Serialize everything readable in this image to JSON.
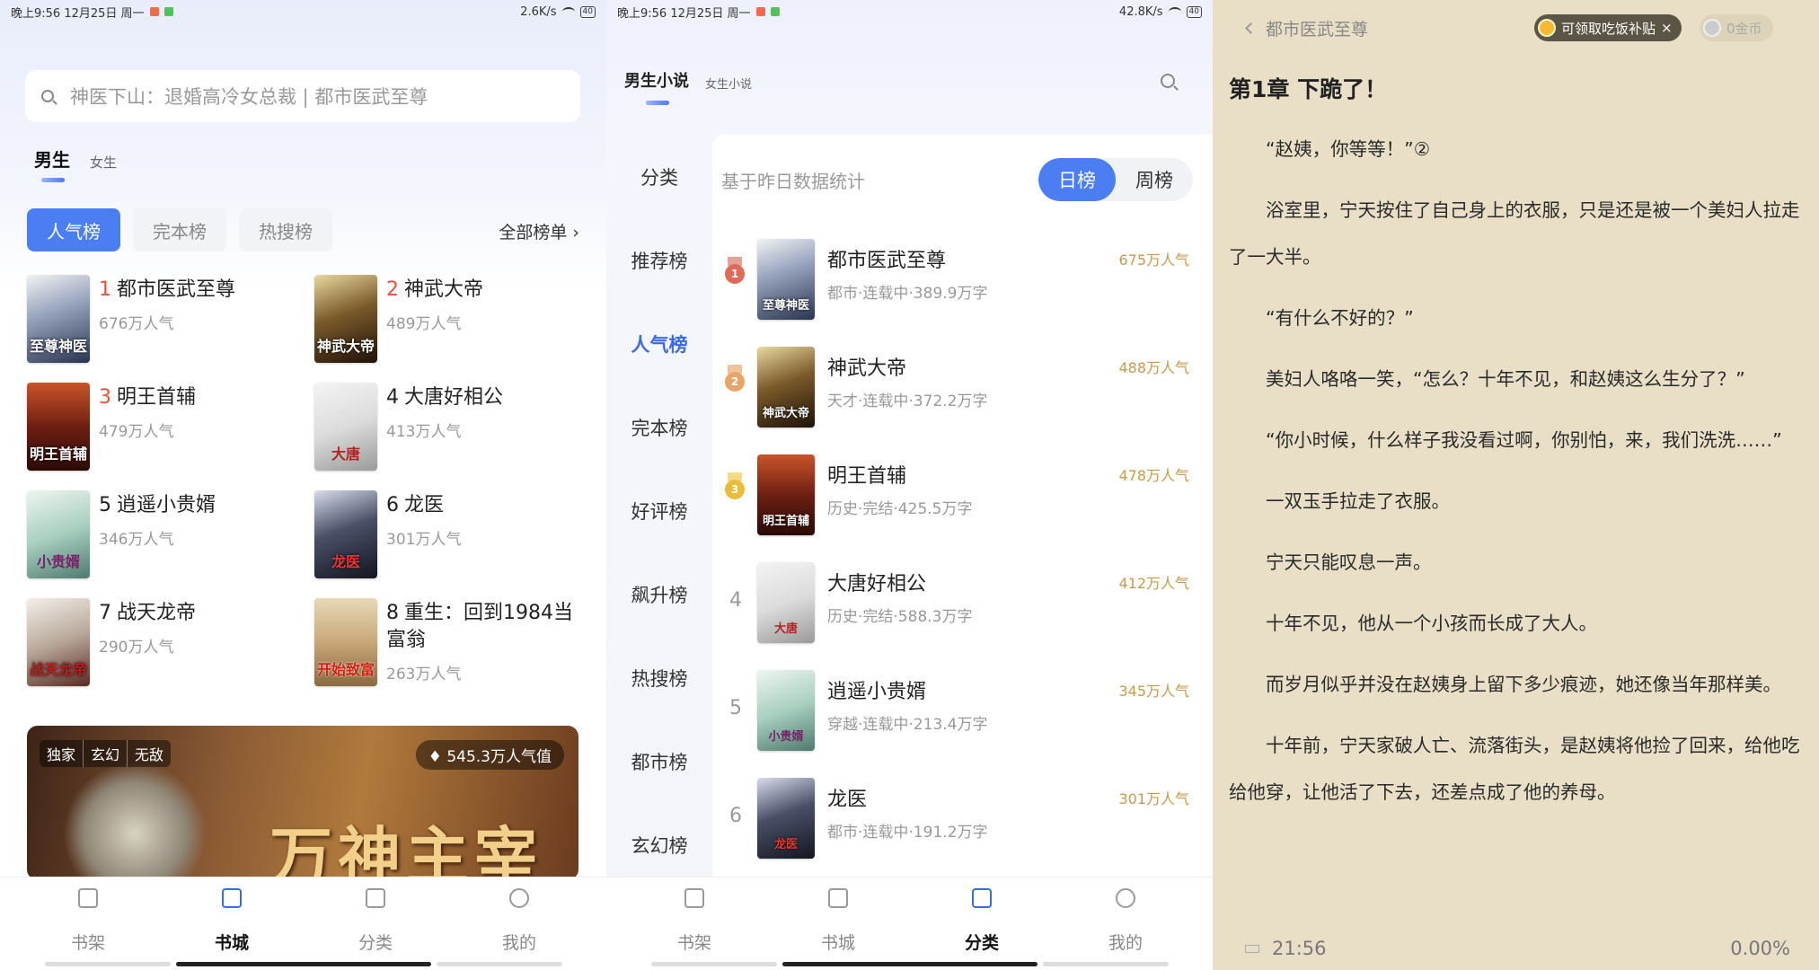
{
  "status1": {
    "left": "晚上9:56 12月25日 周一",
    "right": "2.6K/s",
    "battery": "40"
  },
  "status2": {
    "left": "晚上9:56 12月25日 周一",
    "right": "42.8K/s",
    "battery": "40"
  },
  "store": {
    "search_placeholder": "神医下山：退婚高冷女总裁 | 都市医武至尊",
    "gender_tabs": [
      "男生",
      "女生"
    ],
    "rank_tabs": [
      "人气榜",
      "完本榜",
      "热搜榜"
    ],
    "all_lists": "全部榜单 ›",
    "books": [
      {
        "rank": "1",
        "title": "都市医武至尊",
        "hot": "676万人气",
        "cover": "至尊神医"
      },
      {
        "rank": "2",
        "title": "神武大帝",
        "hot": "489万人气",
        "cover": "神武大帝"
      },
      {
        "rank": "3",
        "title": "明王首辅",
        "hot": "479万人气",
        "cover": "明王首辅"
      },
      {
        "rank": "4",
        "title": "大唐好相公",
        "hot": "413万人气",
        "cover": "大唐"
      },
      {
        "rank": "5",
        "title": "逍遥小贵婿",
        "hot": "346万人气",
        "cover": "小贵婿"
      },
      {
        "rank": "6",
        "title": "龙医",
        "hot": "301万人气",
        "cover": "龙医"
      },
      {
        "rank": "7",
        "title": "战天龙帝",
        "hot": "290万人气",
        "cover": "战天龙帝"
      },
      {
        "rank": "8",
        "title": "重生：回到1984当富翁",
        "hot": "263万人气",
        "cover": "开始致富"
      }
    ],
    "banner": {
      "tags": [
        "独家",
        "玄幻",
        "无敌"
      ],
      "hot": "545.3万人气值",
      "title": "万神主宰"
    }
  },
  "nav": [
    "书架",
    "书城",
    "分类",
    "我的"
  ],
  "category": {
    "top_tabs": [
      "男生小说",
      "女生小说"
    ],
    "side": [
      "分类",
      "推荐榜",
      "人气榜",
      "完本榜",
      "好评榜",
      "飙升榜",
      "热搜榜",
      "都市榜",
      "玄幻榜"
    ],
    "stat_text": "基于昨日数据统计",
    "seg": [
      "日榜",
      "周榜"
    ],
    "rows": [
      {
        "rank": "1",
        "title": "都市医武至尊",
        "meta": "都市·连载中·389.9万字",
        "pop": "675万人气",
        "cover": "至尊神医"
      },
      {
        "rank": "2",
        "title": "神武大帝",
        "meta": "天才·连载中·372.2万字",
        "pop": "488万人气",
        "cover": "神武大帝"
      },
      {
        "rank": "3",
        "title": "明王首辅",
        "meta": "历史·完结·425.5万字",
        "pop": "478万人气",
        "cover": "明王首辅"
      },
      {
        "rank": "4",
        "title": "大唐好相公",
        "meta": "历史·完结·588.3万字",
        "pop": "412万人气",
        "cover": "大唐"
      },
      {
        "rank": "5",
        "title": "逍遥小贵婿",
        "meta": "穿越·连载中·213.4万字",
        "pop": "345万人气",
        "cover": "小贵婿"
      },
      {
        "rank": "6",
        "title": "龙医",
        "meta": "都市·连载中·191.2万字",
        "pop": "301万人气",
        "cover": "龙医"
      }
    ]
  },
  "reader": {
    "back_title": "都市医武至尊",
    "subsidy": "可领取吃饭补贴",
    "gold": "0金币",
    "chapter": "第1章 下跪了！",
    "paras": [
      "“赵姨，你等等！”②",
      "浴室里，宁天按住了自己身上的衣服，只是还是被一个美妇人拉走了一大半。",
      "“有什么不好的？”",
      "美妇人咯咯一笑，“怎么？十年不见，和赵姨这么生分了？”",
      "“你小时候，什么样子我没看过啊，你别怕，来，我们洗洗……”",
      "一双玉手拉走了衣服。",
      "宁天只能叹息一声。",
      "十年不见，他从一个小孩而长成了大人。",
      "而岁月似乎并没在赵姨身上留下多少痕迹，她还像当年那样美。",
      "十年前，宁天家破人亡、流落街头，是赵姨将他捡了回来，给他吃给他穿，让他活了下去，还差点成了他的养母。"
    ],
    "time": "21:56",
    "progress": "0.00%"
  }
}
